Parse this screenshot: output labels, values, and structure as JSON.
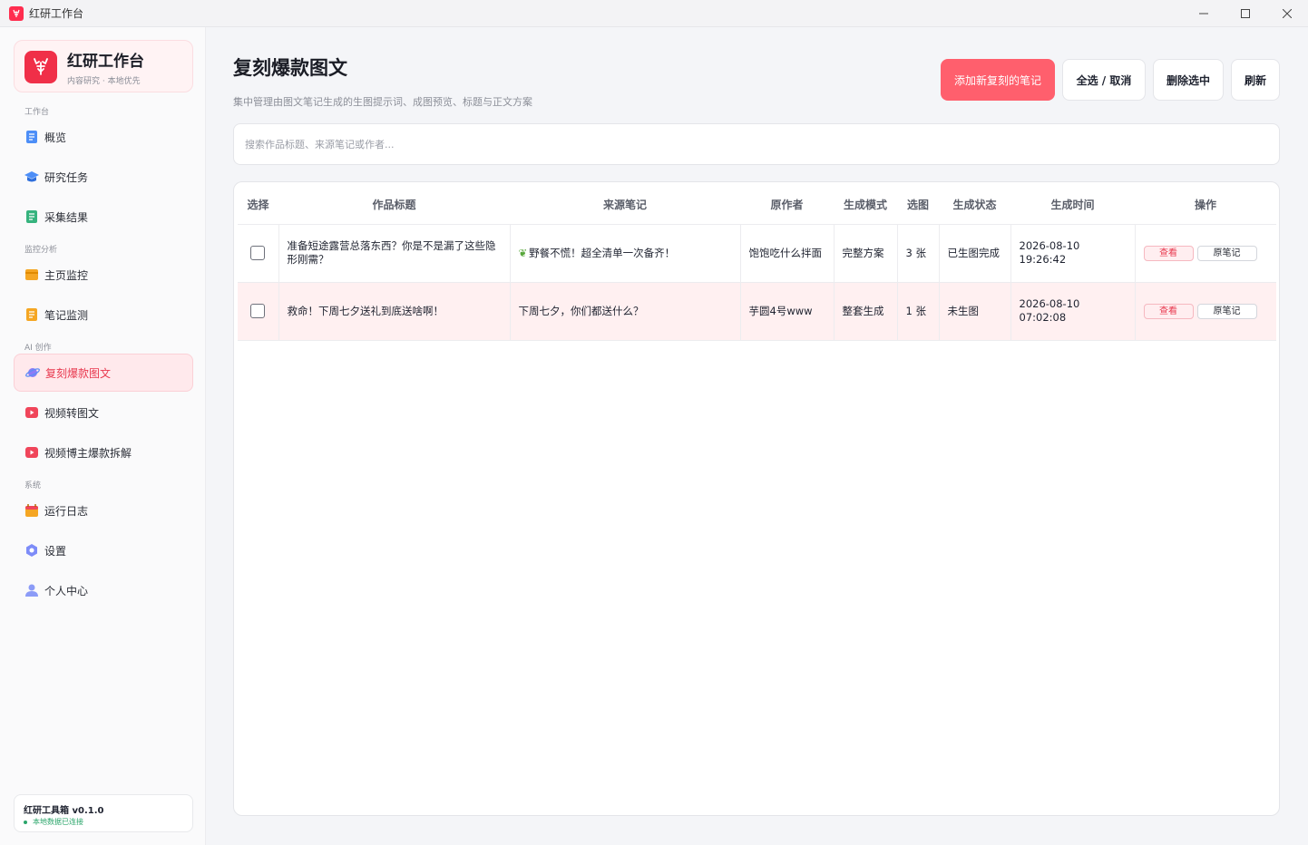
{
  "window": {
    "title": "红研工作台"
  },
  "brand": {
    "name": "红研工作台",
    "subtitle": "内容研究 · 本地优先"
  },
  "sidebar": {
    "sections": [
      "工作台",
      "监控分析",
      "AI 创作",
      "系统"
    ],
    "items": [
      {
        "label": "概览",
        "icon": "doc-icon"
      },
      {
        "label": "研究任务",
        "icon": "graduation-cap-icon"
      },
      {
        "label": "采集结果",
        "icon": "list-doc-icon"
      },
      {
        "label": "主页监控",
        "icon": "card-icon"
      },
      {
        "label": "笔记监测",
        "icon": "note-icon"
      },
      {
        "label": "复刻爆款图文",
        "icon": "planet-icon",
        "active": true
      },
      {
        "label": "视频转图文",
        "icon": "video-icon"
      },
      {
        "label": "视频博主爆款拆解",
        "icon": "video-icon"
      },
      {
        "label": "运行日志",
        "icon": "calendar-icon"
      },
      {
        "label": "设置",
        "icon": "settings-icon"
      },
      {
        "label": "个人中心",
        "icon": "user-icon"
      }
    ]
  },
  "footer": {
    "version": "红研工具箱  v0.1.0",
    "status": "本地数据已连接"
  },
  "main": {
    "title": "复刻爆款图文",
    "description": "集中管理由图文笔记生成的生图提示词、成图预览、标题与正文方案",
    "buttons": {
      "add": "添加新复刻的笔记",
      "select_all": "全选 / 取消",
      "delete": "删除选中",
      "refresh": "刷新"
    },
    "search": {
      "placeholder": "搜索作品标题、来源笔记或作者..."
    },
    "table": {
      "headers": [
        "选择",
        "作品标题",
        "来源笔记",
        "原作者",
        "生成模式",
        "选图",
        "生成状态",
        "生成时间",
        "操作"
      ],
      "rows": [
        {
          "title": "准备短途露营总落东西？你是不是漏了这些隐形刚需？",
          "source": "野餐不慌！超全清单一次备齐！",
          "author": "饱饱吃什么拌面",
          "mode": "完整方案",
          "images": "3 张",
          "status": "已生图完成",
          "time": "2026-08-10 19:26:42",
          "view": "查看",
          "original": "原笔记"
        },
        {
          "title": "救命！下周七夕送礼到底送啥啊！",
          "source": "下周七夕，你们都送什么？",
          "author": "芋圆4号www",
          "mode": "整套生成",
          "images": "1 张",
          "status": "未生图",
          "time": "2026-08-10 07:02:08",
          "view": "查看",
          "original": "原笔记"
        }
      ]
    }
  },
  "colors": {
    "accent": "#ff5f6d",
    "brand": "#f02f48",
    "active_bg": "#ffe9ec",
    "online": "#2aa56a"
  }
}
